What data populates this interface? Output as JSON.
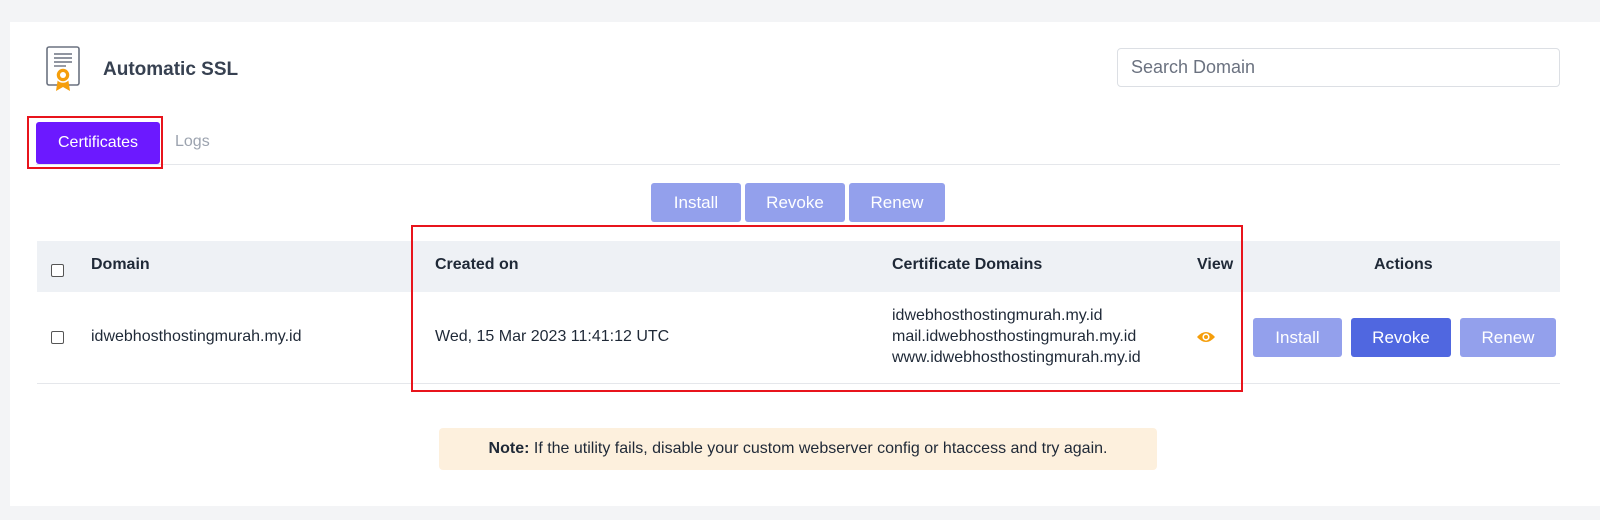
{
  "header": {
    "title": "Automatic SSL",
    "icon": "certificate-icon",
    "search_placeholder": "Search Domain"
  },
  "tabs": [
    {
      "label": "Certificates",
      "active": true
    },
    {
      "label": "Logs",
      "active": false
    }
  ],
  "toolbar": {
    "install_label": "Install",
    "revoke_label": "Revoke",
    "renew_label": "Renew"
  },
  "table": {
    "columns": [
      "Domain",
      "Created on",
      "Certificate Domains",
      "View",
      "Actions"
    ],
    "rows": [
      {
        "domain": "idwebhosthostingmurah.my.id",
        "created_on": "Wed, 15 Mar 2023 11:41:12 UTC",
        "certificate_domains": [
          "idwebhosthostingmurah.my.id",
          "mail.idwebhosthostingmurah.my.id",
          "www.idwebhosthostingmurah.my.id"
        ],
        "view_icon": "eye-icon",
        "actions": {
          "install_label": "Install",
          "revoke_label": "Revoke",
          "renew_label": "Renew"
        }
      }
    ]
  },
  "note": {
    "label": "Note:",
    "text": " If the utility fails, disable your custom webserver config or htaccess and try again."
  },
  "colors": {
    "active_tab": "#6c19ff",
    "button_light": "#93a0ec",
    "button_strong": "#5067e0",
    "eye_icon": "#f59e0b",
    "highlight": "#e8141c",
    "note_bg": "#fdf0dd"
  }
}
